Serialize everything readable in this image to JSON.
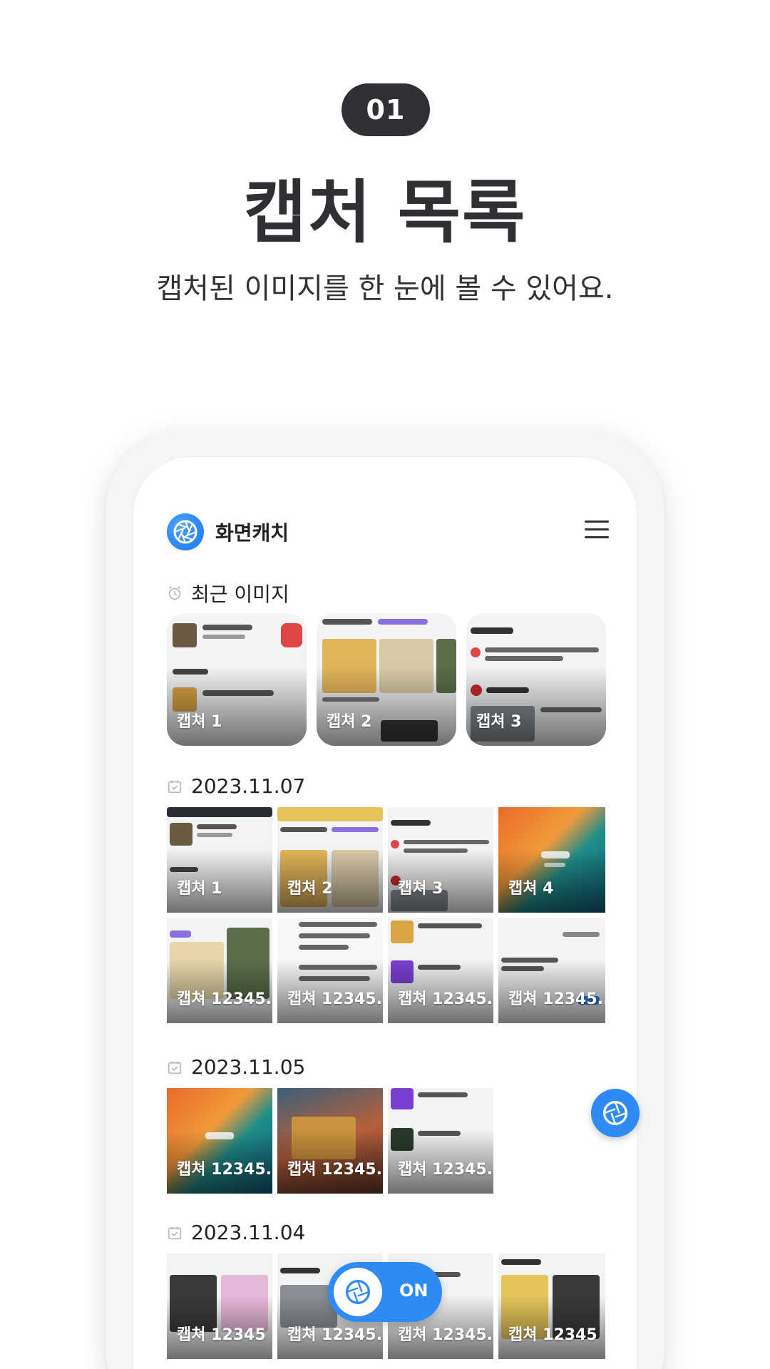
{
  "header": {
    "step_badge": "01",
    "title": "캡처 목록",
    "subtitle": "캡처된 이미지를 한 눈에 볼 수 있어요."
  },
  "app": {
    "name": "화면캐치",
    "logo_icon": "camera-shutter-icon",
    "menu_icon": "hamburger-menu-icon"
  },
  "recent": {
    "label": "최근 이미지",
    "icon": "alarm-clock-icon",
    "items": [
      {
        "caption": "캡쳐 1"
      },
      {
        "caption": "캡쳐 2"
      },
      {
        "caption": "캡쳐 3"
      }
    ]
  },
  "groups": [
    {
      "date": "2023.11.07",
      "icon": "calendar-check-icon",
      "items": [
        {
          "caption": "캡쳐 1"
        },
        {
          "caption": "캡쳐 2"
        },
        {
          "caption": "캡쳐 3"
        },
        {
          "caption": "캡쳐 4"
        },
        {
          "caption": "캡쳐 12345.."
        },
        {
          "caption": "캡쳐 12345.."
        },
        {
          "caption": "캡쳐 12345.."
        },
        {
          "caption": "캡쳐 12345.."
        }
      ]
    },
    {
      "date": "2023.11.05",
      "icon": "calendar-check-icon",
      "items": [
        {
          "caption": "캡쳐 12345.."
        },
        {
          "caption": "캡쳐 12345.."
        },
        {
          "caption": "캡쳐 12345.."
        }
      ]
    },
    {
      "date": "2023.11.04",
      "icon": "calendar-check-icon",
      "items": [
        {
          "caption": "캡쳐 12345"
        },
        {
          "caption": "캡쳐 12345.."
        },
        {
          "caption": "캡쳐 12345.."
        },
        {
          "caption": "캡쳐 12345"
        }
      ]
    }
  ],
  "floating_capture_button": {
    "icon": "camera-shutter-icon"
  },
  "capture_toggle": {
    "label": "ON",
    "icon": "camera-shutter-icon"
  },
  "colors": {
    "accent": "#2e8bf5",
    "badge": "#2f3033",
    "title": "#2f3033"
  }
}
